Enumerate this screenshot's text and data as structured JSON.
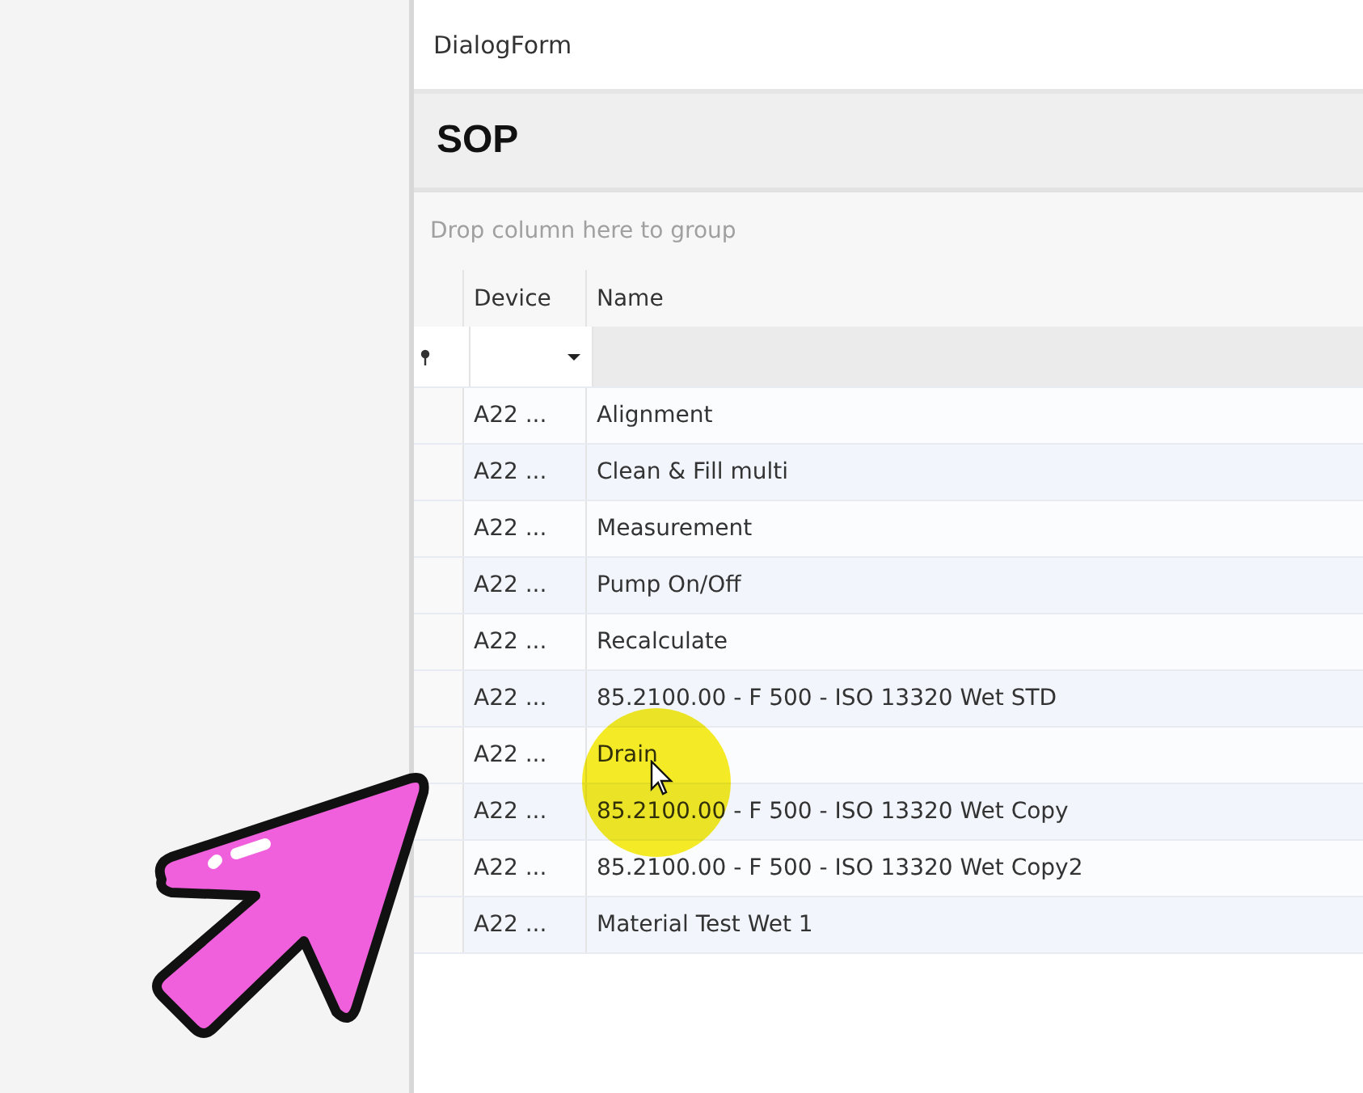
{
  "window": {
    "title": "DialogForm"
  },
  "panel": {
    "title": "SOP"
  },
  "group_panel": {
    "hint": "Drop column here to group"
  },
  "grid": {
    "columns": [
      "Device",
      "Name"
    ],
    "rows": [
      {
        "device": "A22 ...",
        "name": "Alignment"
      },
      {
        "device": "A22 ...",
        "name": "Clean & Fill multi"
      },
      {
        "device": "A22 ...",
        "name": "Measurement"
      },
      {
        "device": "A22 ...",
        "name": "Pump On/Off"
      },
      {
        "device": "A22 ...",
        "name": "Recalculate"
      },
      {
        "device": "A22 ...",
        "name": "85.2100.00 - F 500 - ISO 13320 Wet STD"
      },
      {
        "device": "A22 ...",
        "name": "Drain"
      },
      {
        "device": "A22 ...",
        "name": "85.2100.00 - F 500 - ISO 13320 Wet Copy"
      },
      {
        "device": "A22 ...",
        "name": "85.2100.00 - F 500 - ISO 13320 Wet Copy2"
      },
      {
        "device": "A22 ...",
        "name": "Material Test Wet 1"
      }
    ]
  }
}
